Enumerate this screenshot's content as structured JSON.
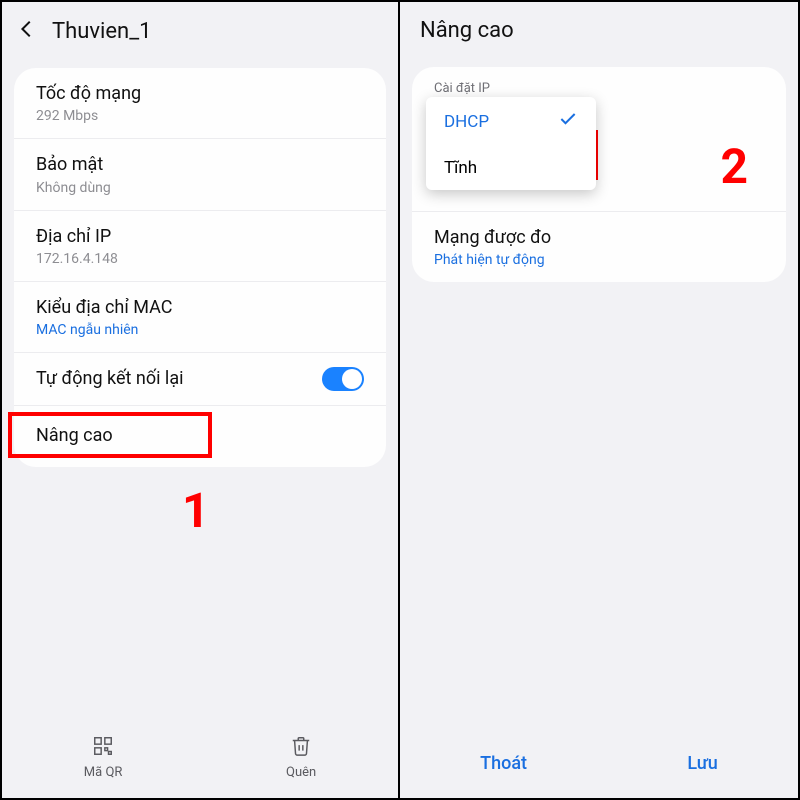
{
  "left": {
    "title": "Thuvien_1",
    "rows": {
      "speed": {
        "title": "Tốc độ mạng",
        "sub": "292 Mbps"
      },
      "security": {
        "title": "Bảo mật",
        "sub": "Không dùng"
      },
      "ip": {
        "title": "Địa chỉ IP",
        "sub": "172.16.4.148"
      },
      "mac": {
        "title": "Kiểu địa chỉ MAC",
        "sub": "MAC ngẫu nhiên"
      },
      "autoreconnect": {
        "title": "Tự động kết nối lại"
      },
      "advanced": {
        "title": "Nâng cao"
      }
    },
    "bottom": {
      "qr": "Mã QR",
      "forget": "Quên"
    },
    "step": "1"
  },
  "right": {
    "title": "Nâng cao",
    "ip_label": "Cài đặt IP",
    "dropdown": {
      "selected": "DHCP",
      "other": "Tĩnh"
    },
    "metered": {
      "title": "Mạng được đo",
      "sub": "Phát hiện tự động"
    },
    "bottom": {
      "exit": "Thoát",
      "save": "Lưu"
    },
    "step": "2"
  }
}
